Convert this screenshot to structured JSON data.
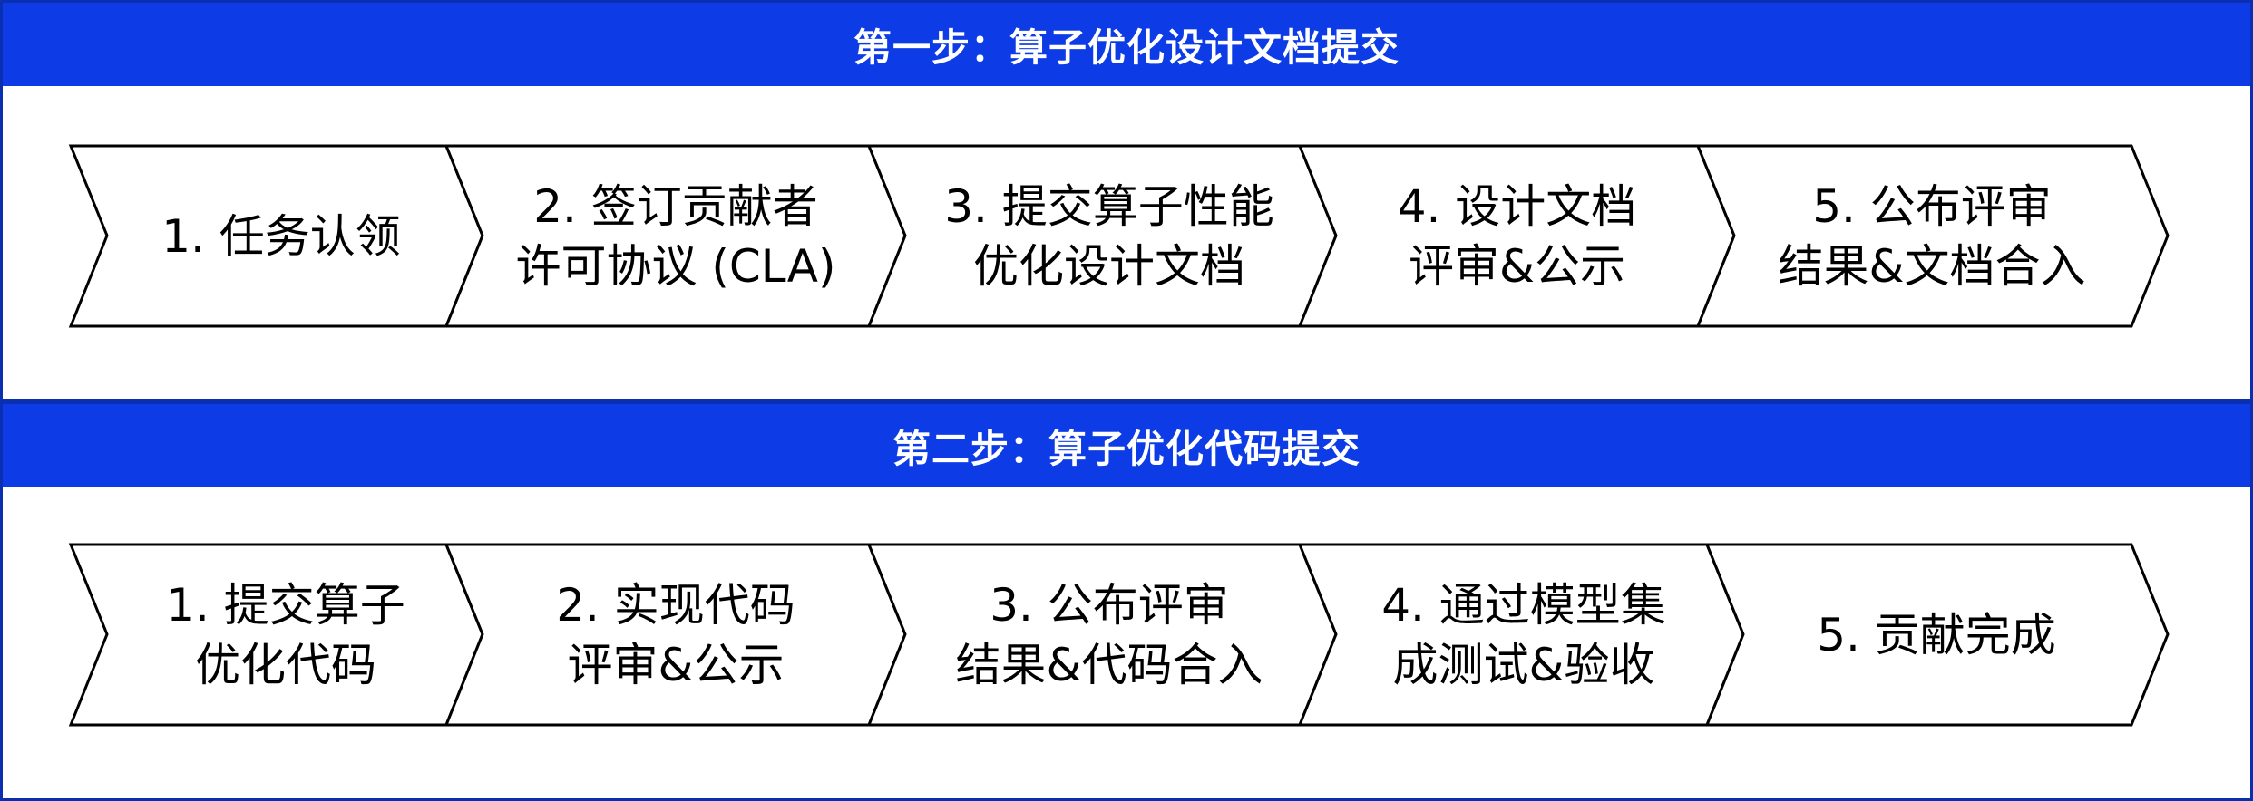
{
  "colors": {
    "header_bg": "#0d3ce6",
    "border": "#0a2fb0",
    "chevron_stroke": "#000000"
  },
  "sections": [
    {
      "title": "第一步：算子优化设计文档提交",
      "steps": [
        {
          "lines": [
            "1. 任务认领"
          ]
        },
        {
          "lines": [
            "2. 签订贡献者",
            "许可协议 (CLA)"
          ]
        },
        {
          "lines": [
            "3. 提交算子性能",
            "优化设计文档"
          ]
        },
        {
          "lines": [
            "4. 设计文档",
            "评审&公示"
          ]
        },
        {
          "lines": [
            "5. 公布评审",
            "结果&文档合入"
          ]
        }
      ]
    },
    {
      "title": "第二步：算子优化代码提交",
      "steps": [
        {
          "lines": [
            "1. 提交算子",
            "优化代码"
          ]
        },
        {
          "lines": [
            "2. 实现代码",
            "评审&公示"
          ]
        },
        {
          "lines": [
            "3. 公布评审",
            "结果&代码合入"
          ]
        },
        {
          "lines": [
            "4. 通过模型集",
            "成测试&验收"
          ]
        },
        {
          "lines": [
            "5. 贡献完成"
          ]
        }
      ]
    }
  ]
}
